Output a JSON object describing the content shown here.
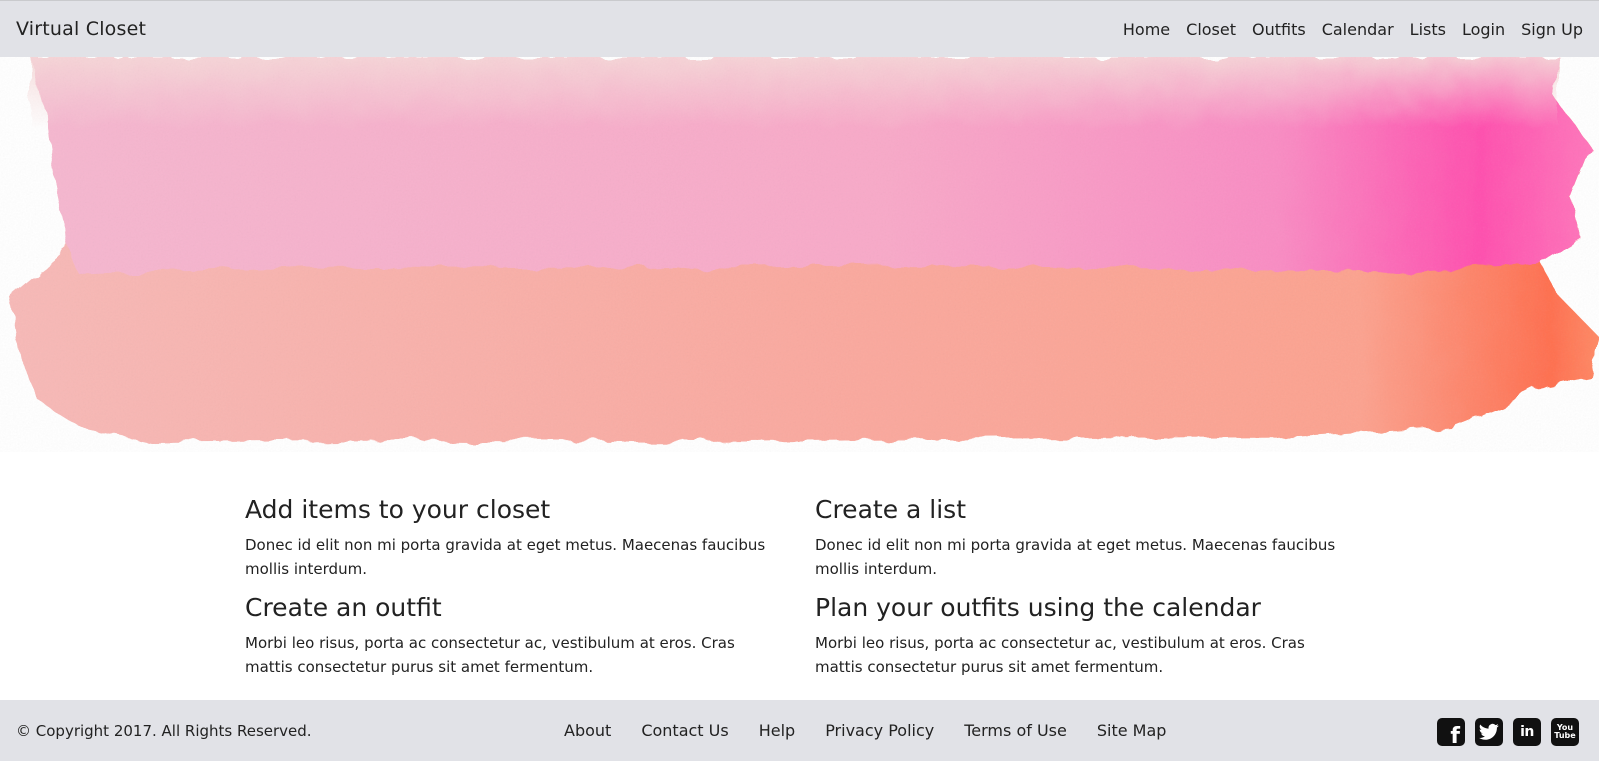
{
  "navbar": {
    "brand": "Virtual Closet",
    "links": [
      "Home",
      "Closet",
      "Outfits",
      "Calendar",
      "Lists",
      "Login",
      "Sign Up"
    ]
  },
  "hero": {
    "image": "pink-orange-watercolor-brush-stroke",
    "colors": {
      "pink": "#f7a5c9",
      "magenta": "#ff3fa8",
      "peach": "#fba99a",
      "orange": "#ff6d4a"
    }
  },
  "features": [
    {
      "title": "Add items to your closet",
      "text": "Donec id elit non mi porta gravida at eget metus. Maecenas faucibus mollis interdum."
    },
    {
      "title": "Create a list",
      "text": "Donec id elit non mi porta gravida at eget metus. Maecenas faucibus mollis interdum."
    },
    {
      "title": "Create an outfit",
      "text": "Morbi leo risus, porta ac consectetur ac, vestibulum at eros. Cras mattis consectetur purus sit amet fermentum."
    },
    {
      "title": "Plan your outfits using the calendar",
      "text": "Morbi leo risus, porta ac consectetur ac, vestibulum at eros. Cras mattis consectetur purus sit amet fermentum."
    }
  ],
  "footer": {
    "copyright": "© Copyright 2017. All Rights Reserved.",
    "links": [
      "About",
      "Contact Us",
      "Help",
      "Privacy Policy",
      "Terms of Use",
      "Site Map"
    ],
    "social": [
      {
        "icon": "facebook-icon",
        "glyph": "f"
      },
      {
        "icon": "twitter-icon",
        "glyph": "🐦"
      },
      {
        "icon": "linkedin-icon",
        "glyph": "in"
      },
      {
        "icon": "youtube-icon",
        "glyph_top": "You",
        "glyph_bottom": "Tube"
      }
    ]
  }
}
